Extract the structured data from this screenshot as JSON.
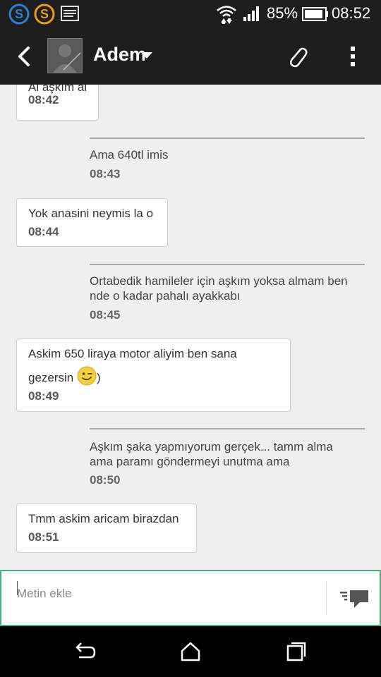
{
  "status_bar": {
    "battery": "85%",
    "time": "08:52",
    "icons": [
      "skype-icon",
      "s-app-icon",
      "messages-icon",
      "wifi-icon",
      "signal-icon",
      "battery-icon"
    ]
  },
  "header": {
    "contact_name": "Adem",
    "icons": [
      "back-arrow-icon",
      "contact-avatar",
      "dropdown-caret-icon",
      "paperclip-icon",
      "overflow-menu-icon"
    ]
  },
  "messages": [
    {
      "direction": "received",
      "text": "Al aşkım al",
      "time": "08:42"
    },
    {
      "direction": "sent",
      "text": "Ama 640tl imis",
      "time": "08:43"
    },
    {
      "direction": "received",
      "text": "Yok anasini neymis la o",
      "time": "08:44"
    },
    {
      "direction": "sent",
      "text_line1": "Ortabedik hamileler  için aşkım yoksa almam ben",
      "text_line2": "nde o kadar pahalı ayakkabı",
      "time": "08:45"
    },
    {
      "direction": "received",
      "text_line1": "Askim 650 liraya motor aliyim ben sana",
      "text_line2_before": "gezersin ",
      "text_line2_after": ")",
      "emoji": "winking-smiley-icon",
      "time": "08:49"
    },
    {
      "direction": "sent",
      "text_line1": "Aşkım şaka yapmıyorum gerçek... tamm alma",
      "text_line2": "ama paramı göndermeyi unutma ama",
      "time": "08:50"
    },
    {
      "direction": "received",
      "text": "Tmm askim aricam birazdan",
      "time": "08:51"
    }
  ],
  "composer": {
    "placeholder": "Metin ekle",
    "send_icon": "send-message-icon"
  },
  "navbar": {
    "icons": [
      "back-nav-icon",
      "home-nav-icon",
      "recent-apps-icon"
    ]
  },
  "colors": {
    "bar_bg": "#1e1e1e",
    "chat_bg": "#efefef",
    "composer_border": "#4caf7d"
  }
}
